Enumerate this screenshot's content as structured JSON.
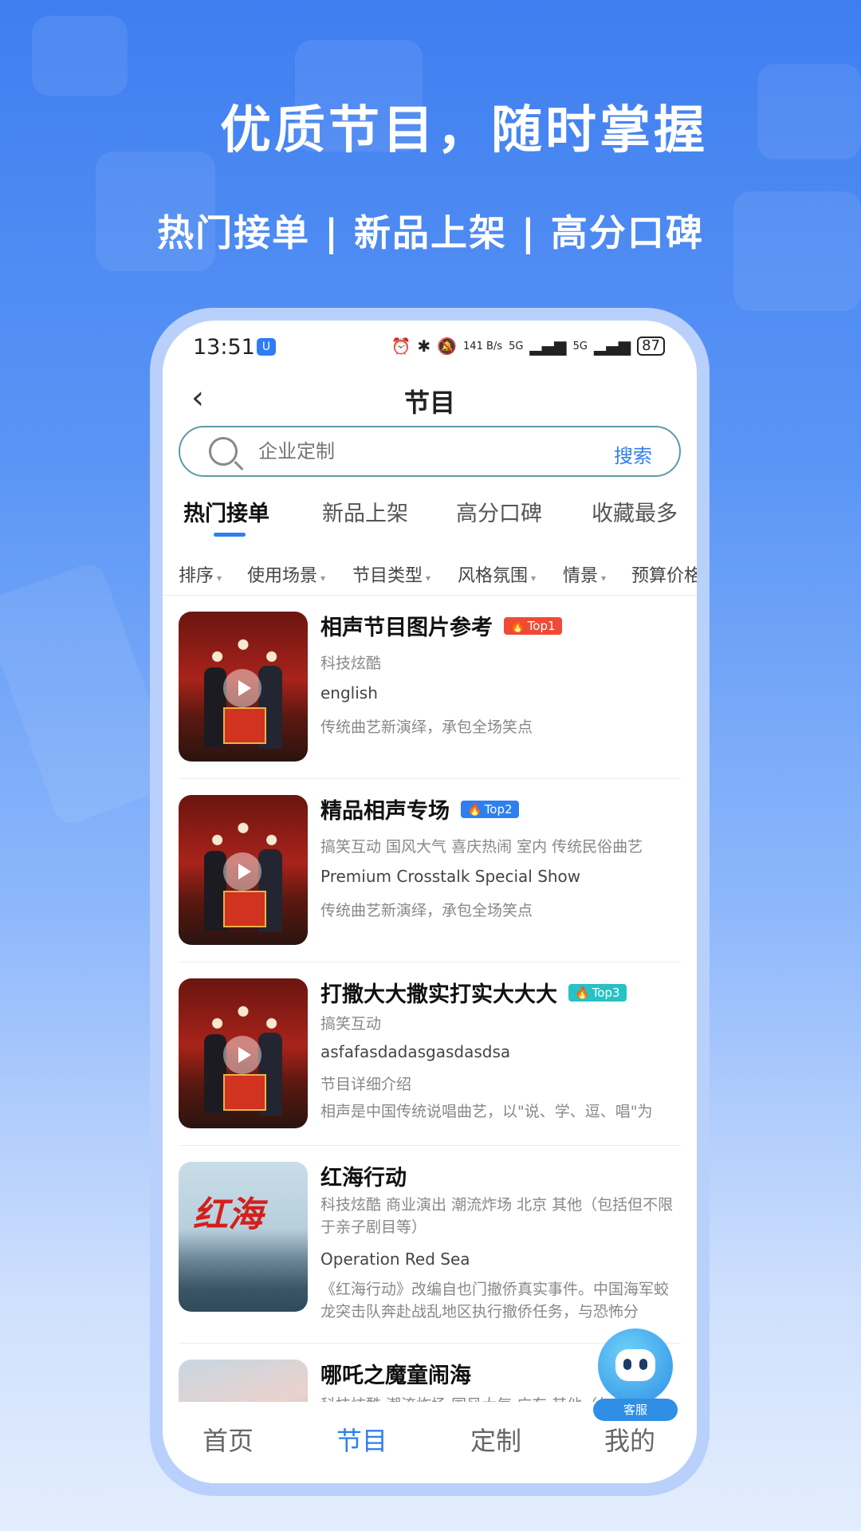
{
  "promo": {
    "headline": "优质节目，随时掌握",
    "subline": "热门接单 | 新品上架 | 高分口碑"
  },
  "status_bar": {
    "time": "13:51",
    "network_speed": "141 B/s",
    "signal1": "5G",
    "signal2": "5G",
    "battery": "87"
  },
  "nav": {
    "back_icon": "chevron-left-icon",
    "title": "节目"
  },
  "search": {
    "placeholder": "企业定制",
    "button_label": "搜索"
  },
  "tabs": [
    "热门接单",
    "新品上架",
    "高分口碑",
    "收藏最多"
  ],
  "active_tab": 0,
  "filters": [
    "排序",
    "使用场景",
    "节目类型",
    "风格氛围",
    "情景",
    "预算价格"
  ],
  "items": [
    {
      "title": "相声节目图片参考",
      "badge": "Top1",
      "line1": "科技炫酷",
      "line2": "english",
      "line3": "传统曲艺新演绎，承包全场笑点",
      "thumb": "crosstalk-stage"
    },
    {
      "title": "精品相声专场",
      "badge": "Top2",
      "line1": "搞笑互动 国风大气 喜庆热闹 室内 传统民俗曲艺",
      "line2": "Premium Crosstalk Special Show",
      "line3": "传统曲艺新演绎，承包全场笑点",
      "thumb": "crosstalk-stage"
    },
    {
      "title": "打撒大大撒实打实大大大",
      "badge": "Top3",
      "line1": "搞笑互动",
      "line2": "asfafasdadasgasdasdsa",
      "line3": "节目详细介绍",
      "line4": "相声是中国传统说唱曲艺，以\"说、学、逗、唱\"为",
      "thumb": "crosstalk-stage"
    },
    {
      "title": "红海行动",
      "line1": "科技炫酷 商业演出 潮流炸场 北京 其他（包括但不限于亲子剧目等）",
      "line2": "Operation Red Sea",
      "line3": "《红海行动》改编自也门撤侨真实事件。中国海军蛟龙突击队奔赴战乱地区执行撤侨任务，与恐怖分",
      "thumb": "red-sea-poster",
      "poster_text": "红海"
    },
    {
      "title": "哪吒之魔童闹海",
      "line1": "科技炫酷 潮流炸场 国风大气 广东 其他（包括但不",
      "thumb": "nezha-poster"
    }
  ],
  "customer_service": {
    "label": "客服",
    "icon": "robot-icon"
  },
  "bottom_nav": [
    "首页",
    "节目",
    "定制",
    "我的"
  ],
  "bottom_active": 1,
  "colors": {
    "accent": "#2d7ff1",
    "top1": "#ef4a35",
    "top2": "#2d7ff1",
    "top3": "#27c1c6"
  }
}
